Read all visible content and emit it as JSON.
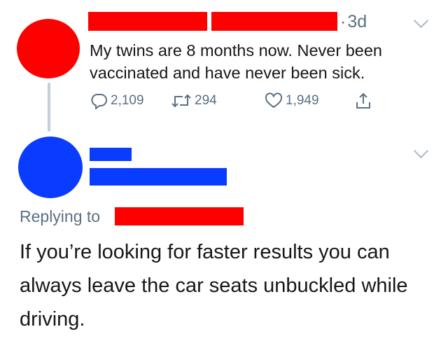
{
  "tweets": [
    {
      "timestamp": "3d",
      "text": "My twins are 8 months now. Never been vaccinated and have never been sick.",
      "actions": {
        "reply_count": "2,109",
        "retweet_count": "294",
        "like_count": "1,949"
      }
    },
    {
      "replying_to_label": "Replying to",
      "text": "If you’re looking for faster results you can always leave the car seats unbuckled while driving."
    }
  ],
  "colors": {
    "redaction_red": "#ff0000",
    "redaction_blue": "#0a3cff",
    "secondary_text": "#5b7083",
    "primary_text": "#14171a",
    "thread_line": "#c4cfd6"
  },
  "icons": {
    "reply": "reply-icon",
    "retweet": "retweet-icon",
    "like": "heart-icon",
    "share": "share-icon",
    "more": "chevron-down-icon"
  }
}
